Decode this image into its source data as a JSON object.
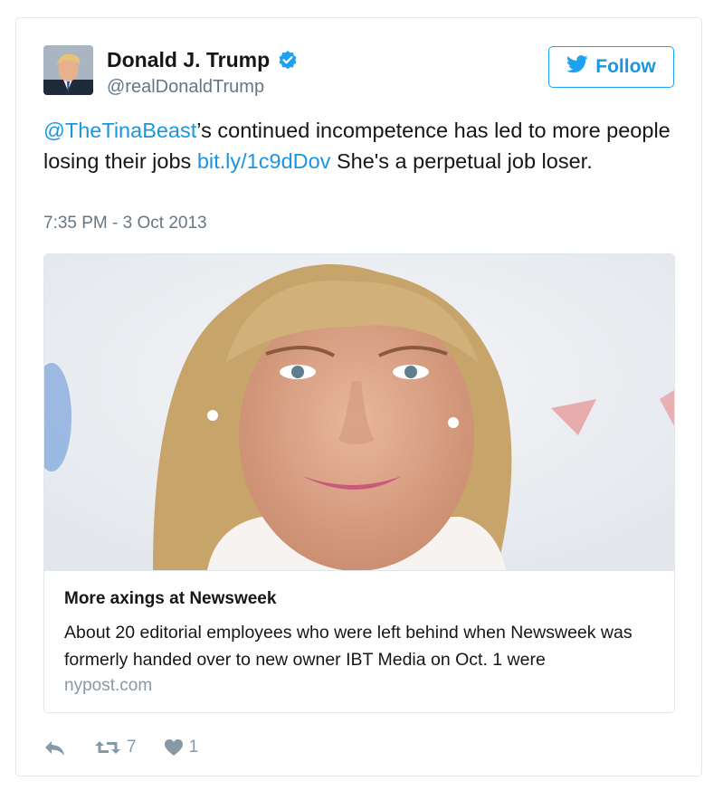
{
  "tweet": {
    "display_name": "Donald J. Trump",
    "handle": "@realDonaldTrump",
    "follow_label": "Follow",
    "text": {
      "mention": "@TheTinaBeast",
      "part1": "’s continued incompetence has led to more people losing their jobs ",
      "link": "bit.ly/1c9dDov",
      "part2": " She's a perpetual job loser."
    },
    "timestamp": "7:35 PM - 3 Oct 2013"
  },
  "card": {
    "title": "More axings at Newsweek",
    "description": "About 20 editorial employees who were left behind when Newsweek was formerly handed over to new owner IBT Media on Oct. 1 were",
    "domain": "nypost.com"
  },
  "actions": {
    "retweet_count": "7",
    "like_count": "1"
  },
  "colors": {
    "accent": "#1b95e0",
    "text": "#14171a",
    "muted": "#657786",
    "border": "#e1e8ed"
  },
  "icons": [
    "verified-badge-icon",
    "twitter-bird-icon",
    "reply-icon",
    "retweet-icon",
    "heart-icon"
  ]
}
